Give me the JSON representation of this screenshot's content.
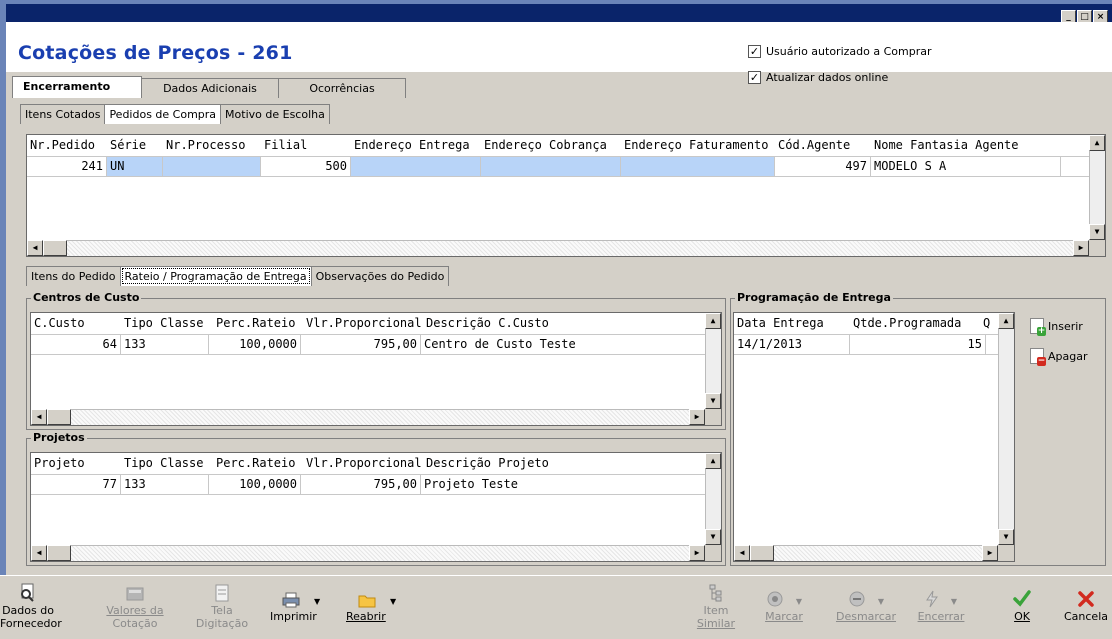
{
  "window": {
    "title": "Cotações de Preços - 261",
    "controls": [
      "_",
      "□",
      "×"
    ]
  },
  "header": {
    "checkbox_authorized": {
      "label": "Usuário autorizado a Comprar",
      "checked": true
    },
    "checkbox_online": {
      "label": "Atualizar dados online",
      "checked": true
    }
  },
  "main_tabs": [
    {
      "label": "Encerramento",
      "active": true
    },
    {
      "label": "Dados Adicionais",
      "active": false
    },
    {
      "label": "Ocorrências",
      "active": false
    }
  ],
  "sub_tabs": [
    {
      "label": "Itens Cotados",
      "active": false
    },
    {
      "label": "Pedidos de Compra",
      "active": true
    },
    {
      "label": "Motivo de Escolha",
      "active": false
    }
  ],
  "orders_grid": {
    "columns": [
      "Nr.Pedido",
      "Série",
      "Nr.Processo",
      "Filial",
      "Endereço Entrega",
      "Endereço Cobrança",
      "Endereço Faturamento",
      "Cód.Agente",
      "Nome Fantasia Agente"
    ],
    "rows": [
      [
        "241",
        "UN",
        "",
        "500",
        "",
        "",
        "",
        "497",
        "MODELO S A"
      ]
    ]
  },
  "order_tabs": [
    {
      "label": "Itens do Pedido",
      "active": false
    },
    {
      "label": "Rateio / Programação de Entrega",
      "active": true
    },
    {
      "label": "Observações do Pedido",
      "active": false
    }
  ],
  "cost_centers": {
    "title": "Centros de Custo",
    "columns": [
      "C.Custo",
      "Tipo Classe",
      "Perc.Rateio",
      "Vlr.Proporcional",
      "Descrição C.Custo"
    ],
    "rows": [
      [
        "64",
        "133",
        "100,0000",
        "795,00",
        "Centro de Custo Teste"
      ]
    ]
  },
  "projects": {
    "title": "Projetos",
    "columns": [
      "Projeto",
      "Tipo Classe",
      "Perc.Rateio",
      "Vlr.Proporcional",
      "Descrição Projeto"
    ],
    "rows": [
      [
        "77",
        "133",
        "100,0000",
        "795,00",
        "Projeto Teste"
      ]
    ]
  },
  "delivery": {
    "title": "Programação de Entrega",
    "columns": [
      "Data Entrega",
      "Qtde.Programada",
      "Q"
    ],
    "rows": [
      [
        "14/1/2013",
        "15",
        ""
      ]
    ],
    "insert_label": "Inserir",
    "delete_label": "Apagar"
  },
  "toolbar": {
    "supplier_data": [
      "Dados do",
      "Fornecedor"
    ],
    "quote_values": [
      "Valores da",
      "Cotação"
    ],
    "typing_screen": [
      "Tela",
      "Digitação"
    ],
    "print": "Imprimir",
    "reopen": "Reabrir",
    "similar_item": [
      "Item",
      "Similar"
    ],
    "mark": "Marcar",
    "unmark": "Desmarcar",
    "close": "Encerrar",
    "ok": "OK",
    "cancel": "Cancela"
  },
  "colors": {
    "title_blue": "#1a3fb0",
    "titlebar": "#0a246a",
    "selected_cell": "#b8d4f8",
    "ok_green": "#3aa33a",
    "cancel_red": "#d22a1f"
  }
}
